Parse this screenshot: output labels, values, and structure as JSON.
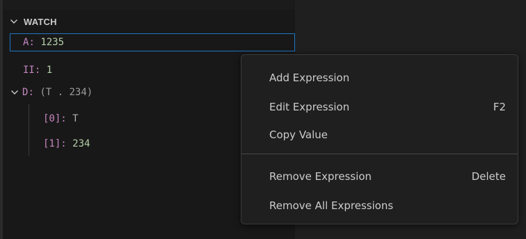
{
  "watch": {
    "title": "WATCH",
    "items": [
      {
        "name": "A",
        "colon": ":",
        "value": "1235"
      },
      {
        "name": "II",
        "colon": ":",
        "value": "1"
      },
      {
        "name": "D",
        "colon": ":",
        "value": "(T . 234)"
      }
    ],
    "children": [
      {
        "name": "[0]",
        "colon": ":",
        "value": "T"
      },
      {
        "name": "[1]",
        "colon": ":",
        "value": "234"
      }
    ]
  },
  "context_menu": {
    "items": [
      {
        "label": "Add Expression",
        "shortcut": ""
      },
      {
        "label": "Edit Expression",
        "shortcut": "F2"
      },
      {
        "label": "Copy Value",
        "shortcut": ""
      },
      {
        "label": "Remove Expression",
        "shortcut": "Delete"
      },
      {
        "label": "Remove All Expressions",
        "shortcut": ""
      }
    ]
  },
  "colors": {
    "variable_name": "#c586c0",
    "number_value": "#b5cea8",
    "focus_border": "#1e77c8",
    "menu_background": "#1f1f1f"
  }
}
